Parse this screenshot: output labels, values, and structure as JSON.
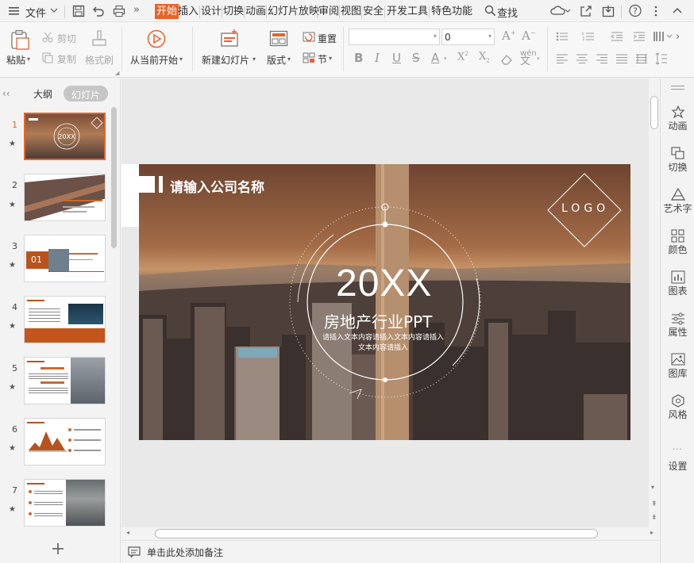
{
  "menu": {
    "file": "文件",
    "search": "查找"
  },
  "tabs": [
    "开始",
    "插入",
    "设计",
    "切换",
    "动画",
    "幻灯片放映",
    "审阅",
    "视图",
    "安全",
    "开发工具",
    "特色功能"
  ],
  "ribbon": {
    "paste": "粘贴",
    "cut": "剪切",
    "copy": "复制",
    "format_painter": "格式刷",
    "from_current": "从当前开始",
    "new_slide": "新建幻灯片",
    "layout": "版式",
    "reset": "重置",
    "section": "节",
    "font_size": "0",
    "font_name": ""
  },
  "left_panel": {
    "tab_outline": "大纲",
    "tab_slides": "幻灯片",
    "slide_numbers": [
      "1",
      "2",
      "3",
      "4",
      "5",
      "6",
      "7"
    ],
    "add_icon": "plus-icon",
    "thumb3_label": "01"
  },
  "slide": {
    "company": "请输入公司名称",
    "logo": "LOGO",
    "year": "20XX",
    "title": "房地产行业PPT",
    "subtitle_line1": "请插入文本内容请插入文本内容请插入",
    "subtitle_line2": "文本内容请插入"
  },
  "right_panel": [
    "动画",
    "切换",
    "艺术字",
    "颜色",
    "图表",
    "属性",
    "图库",
    "风格",
    "设置"
  ],
  "notes": {
    "placeholder": "单击此处添加备注"
  },
  "colors": {
    "accent": "#e8632a"
  }
}
